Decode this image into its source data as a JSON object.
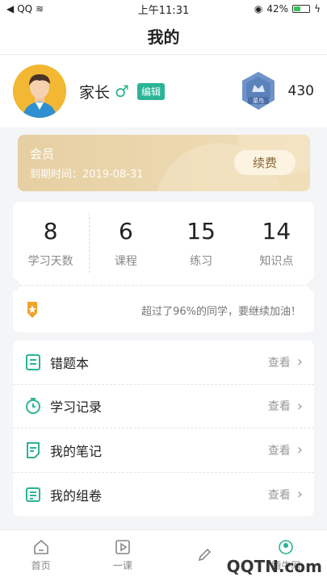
{
  "status": {
    "carrier": "QQ",
    "time": "上午11:31",
    "battery": "42%"
  },
  "nav": {
    "title": "我的"
  },
  "profile": {
    "name": "家长",
    "gender": "♂",
    "edit": "编辑",
    "rank_badge": "菜鸟",
    "score": "430"
  },
  "member": {
    "title": "会员",
    "expire": "到期时间：2019-08-31",
    "renew": "续费"
  },
  "stats": [
    {
      "value": "8",
      "label": "学习天数"
    },
    {
      "value": "6",
      "label": "课程"
    },
    {
      "value": "15",
      "label": "练习"
    },
    {
      "value": "14",
      "label": "知识点"
    }
  ],
  "tip": "超过了96%的同学，要继续加油！",
  "list": [
    {
      "label": "错题本",
      "action": "查看"
    },
    {
      "label": "学习记录",
      "action": "查看"
    },
    {
      "label": "我的笔记",
      "action": "查看"
    },
    {
      "label": "我的组卷",
      "action": "查看"
    }
  ],
  "tabs": [
    "首页",
    "一课",
    "",
    "腾牛网"
  ],
  "watermark": "QQTN.com"
}
